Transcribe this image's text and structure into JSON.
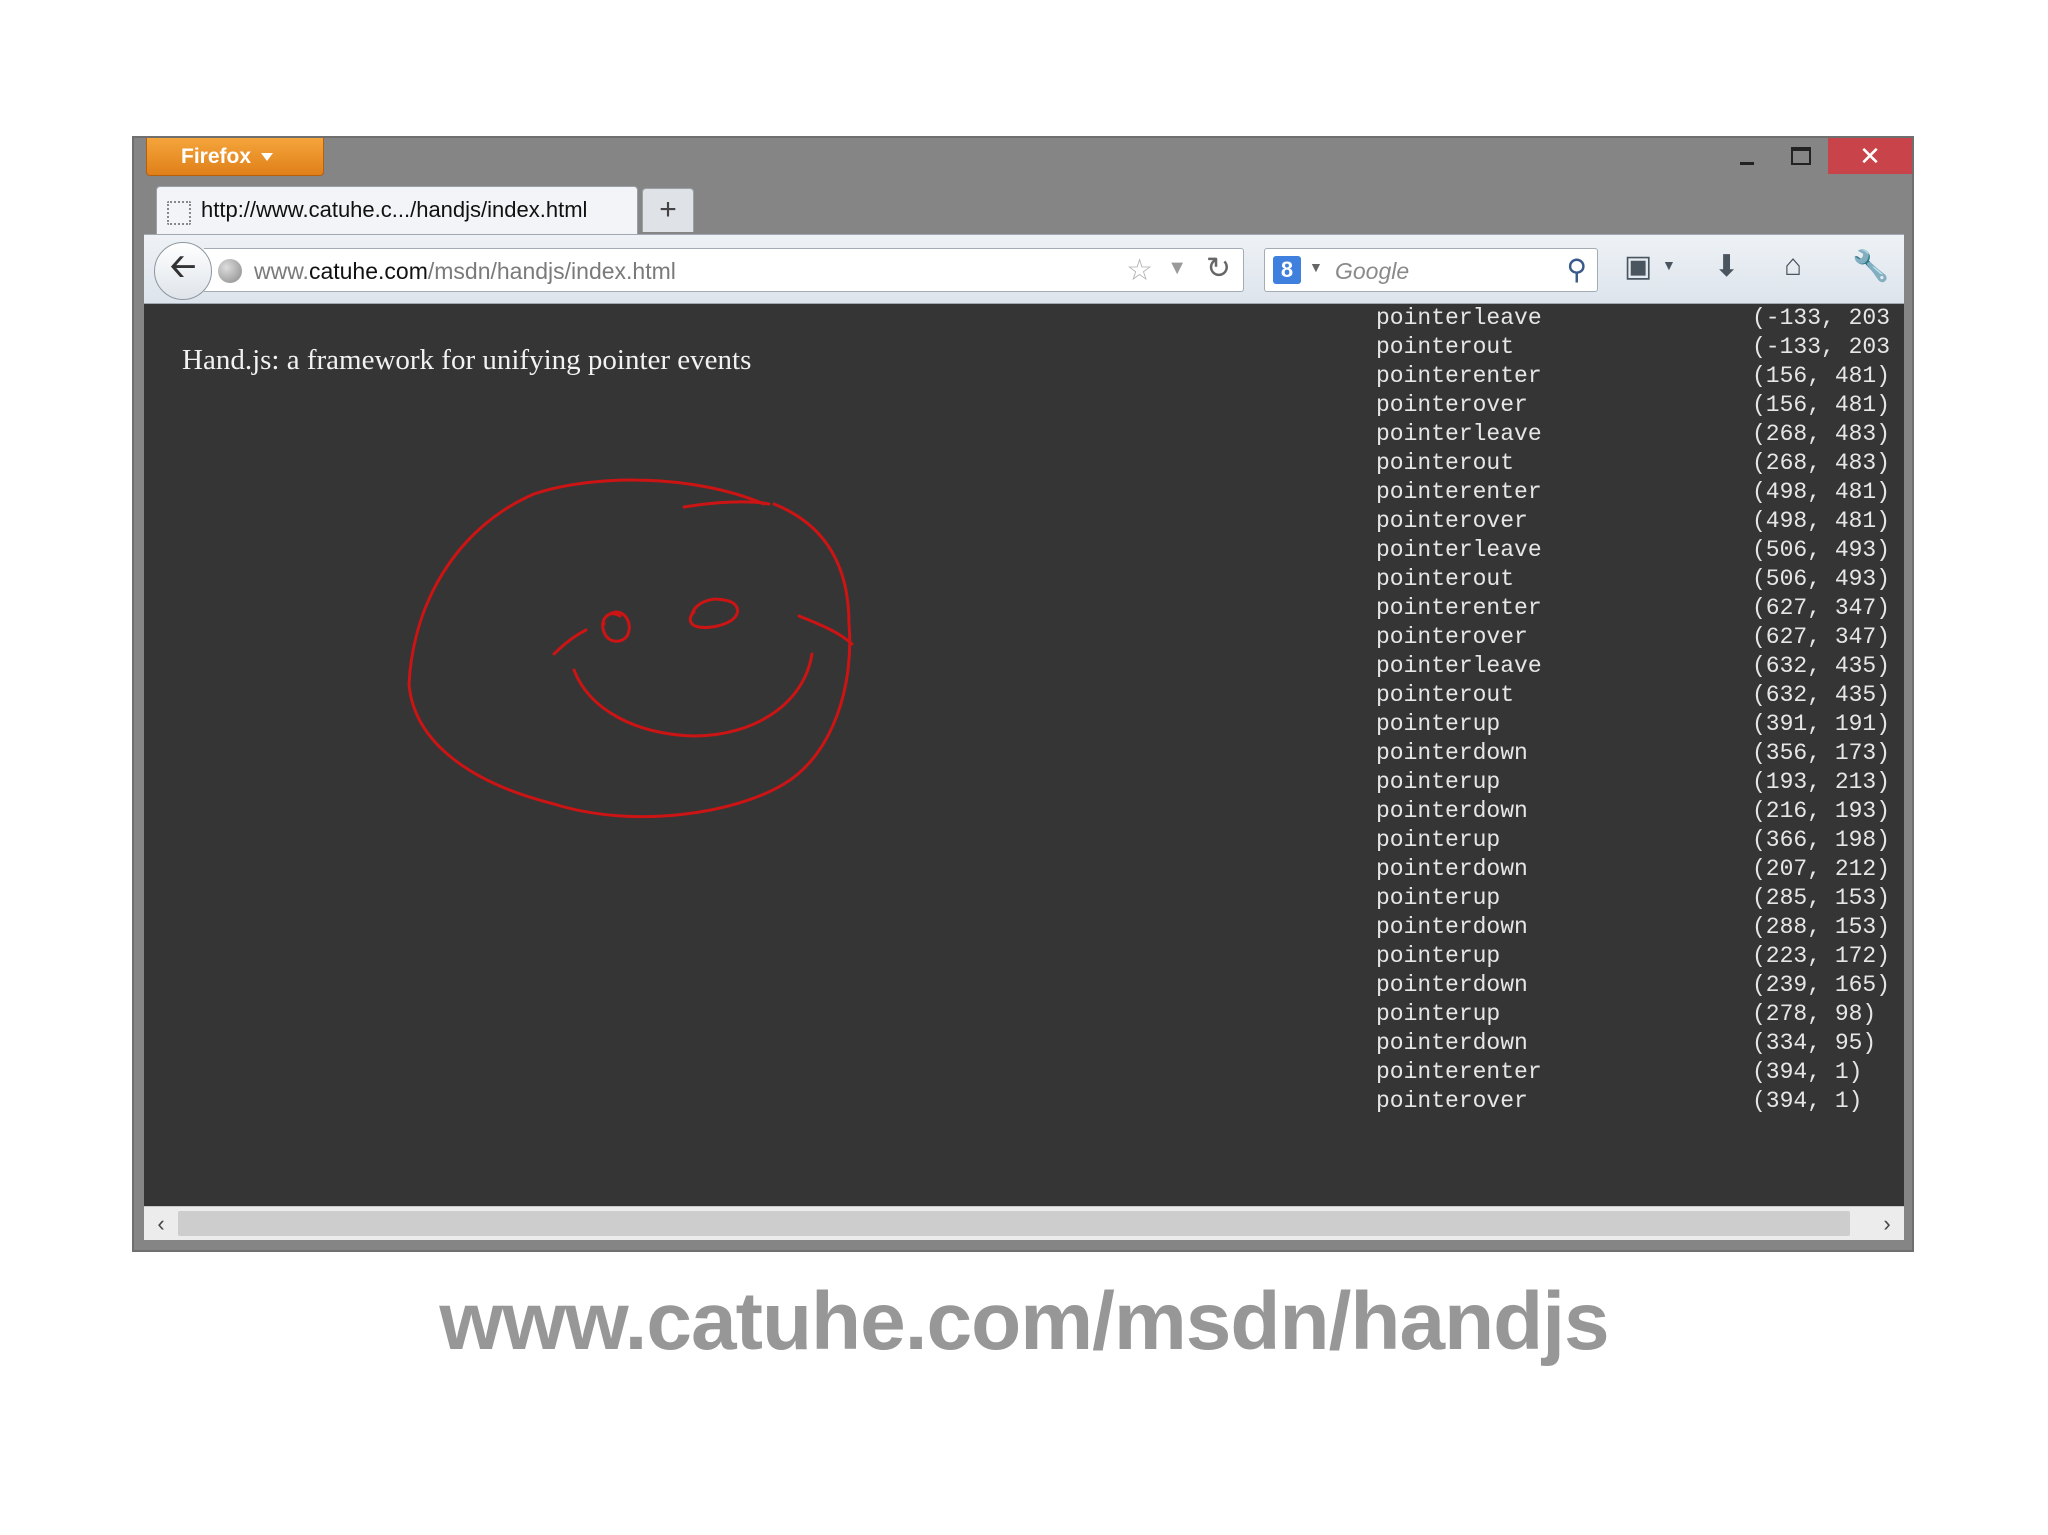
{
  "browser": {
    "menu_button": "Firefox",
    "tab": {
      "title": "http://www.catuhe.c.../handjs/index.html"
    },
    "new_tab": "+",
    "url": {
      "prefix": "www.",
      "host": "catuhe.com",
      "path": "/msdn/handjs/index.html"
    },
    "search": {
      "engine_icon": "8",
      "placeholder": "Google"
    },
    "window_controls": {
      "close": "✕"
    }
  },
  "page": {
    "title": "Hand.js: a framework for unifying pointer events",
    "drawing_color": "#cc1414",
    "event_log": [
      {
        "event": "pointerleave",
        "coords": "(-133, 203"
      },
      {
        "event": "pointerout",
        "coords": "(-133, 203"
      },
      {
        "event": "pointerenter",
        "coords": "(156, 481)"
      },
      {
        "event": "pointerover",
        "coords": "(156, 481)"
      },
      {
        "event": "pointerleave",
        "coords": "(268, 483)"
      },
      {
        "event": "pointerout",
        "coords": "(268, 483)"
      },
      {
        "event": "pointerenter",
        "coords": "(498, 481)"
      },
      {
        "event": "pointerover",
        "coords": "(498, 481)"
      },
      {
        "event": "pointerleave",
        "coords": "(506, 493)"
      },
      {
        "event": "pointerout",
        "coords": "(506, 493)"
      },
      {
        "event": "pointerenter",
        "coords": "(627, 347)"
      },
      {
        "event": "pointerover",
        "coords": "(627, 347)"
      },
      {
        "event": "pointerleave",
        "coords": "(632, 435)"
      },
      {
        "event": "pointerout",
        "coords": "(632, 435)"
      },
      {
        "event": "pointerup",
        "coords": "(391, 191)"
      },
      {
        "event": "pointerdown",
        "coords": "(356, 173)"
      },
      {
        "event": "pointerup",
        "coords": "(193, 213)"
      },
      {
        "event": "pointerdown",
        "coords": "(216, 193)"
      },
      {
        "event": "pointerup",
        "coords": "(366, 198)"
      },
      {
        "event": "pointerdown",
        "coords": "(207, 212)"
      },
      {
        "event": "pointerup",
        "coords": "(285, 153)"
      },
      {
        "event": "pointerdown",
        "coords": "(288, 153)"
      },
      {
        "event": "pointerup",
        "coords": "(223, 172)"
      },
      {
        "event": "pointerdown",
        "coords": "(239, 165)"
      },
      {
        "event": "pointerup",
        "coords": "(278, 98)"
      },
      {
        "event": "pointerdown",
        "coords": "(334, 95)"
      },
      {
        "event": "pointerenter",
        "coords": "(394, 1)"
      },
      {
        "event": "pointerover",
        "coords": "(394, 1)"
      }
    ]
  },
  "caption": "www.catuhe.com/msdn/handjs"
}
